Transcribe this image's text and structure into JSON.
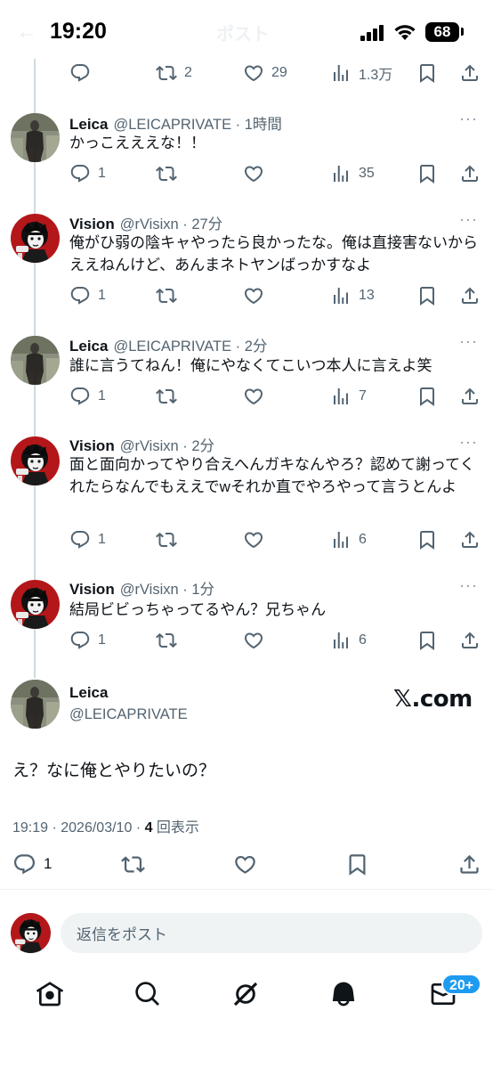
{
  "status_bar": {
    "time": "19:20",
    "battery": "68"
  },
  "header": {
    "back": "←",
    "title": "ポスト"
  },
  "top_actions": {
    "retweets": "2",
    "likes": "29",
    "views": "1.3万"
  },
  "replies": [
    {
      "name": "Leica",
      "handle": "@LEICAPRIVATE · 1時間",
      "text": "かっこえええな！！",
      "replies": "1",
      "retweets": "",
      "likes": "",
      "views": "35"
    },
    {
      "name": "Vision",
      "handle": "@rVisixn · 27分",
      "text": "俺がひ弱の陰キャやったら良かったな。俺は直接害ないからええねんけど、あんまネトヤンばっかすなよ",
      "replies": "1",
      "retweets": "",
      "likes": "",
      "views": "13"
    },
    {
      "name": "Leica",
      "handle": "@LEICAPRIVATE · 2分",
      "text": "誰に言うてねん！俺にやなくてこいつ本人に言えよ笑",
      "replies": "1",
      "retweets": "",
      "likes": "",
      "views": "7"
    },
    {
      "name": "Vision",
      "handle": "@rVisixn · 2分",
      "text": "面と面向かってやり合えへんガキなんやろ？認めて謝ってくれたらなんでもええでwそれか直でやろやって言うとんよ",
      "replies": "1",
      "retweets": "",
      "likes": "",
      "views": "6"
    },
    {
      "name": "Vision",
      "handle": "@rVisixn · 1分",
      "text": "結局ビビっちゃってるやん？兄ちゃん",
      "replies": "1",
      "retweets": "",
      "likes": "",
      "views": "6"
    }
  ],
  "main_tweet": {
    "name": "Leica",
    "handle": "@LEICAPRIVATE",
    "watermark": "𝕏.com",
    "text": "え？なに俺とやりたいの？",
    "timestamp": "19:19 · 2026/03/10 · ",
    "view_count": "4",
    "view_label": "回表示",
    "replies": "1"
  },
  "composer": {
    "placeholder": "返信をポスト"
  },
  "bottom_nav": {
    "badge": "20+"
  },
  "colors": {
    "accent": "#1d9bf0",
    "text": "#0f1419",
    "secondary": "#536471",
    "thread_line": "#cfd9de"
  }
}
